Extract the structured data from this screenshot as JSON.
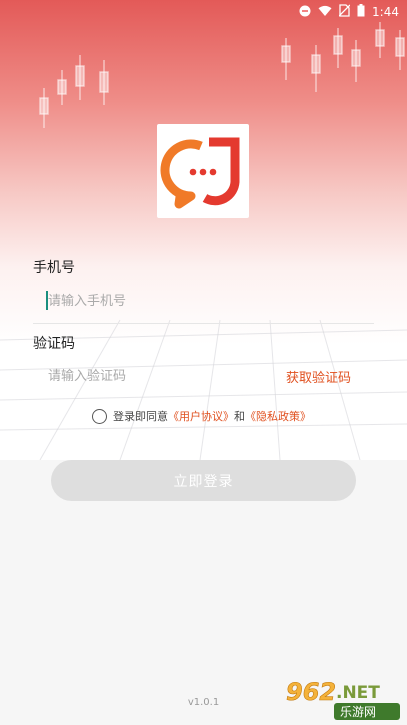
{
  "status_bar": {
    "time": "1:44",
    "icons": [
      "minus-circle-icon",
      "wifi-icon",
      "no-sim-icon",
      "battery-icon"
    ]
  },
  "login": {
    "phone_label": "手机号",
    "phone_placeholder": "请输入手机号",
    "code_label": "验证码",
    "code_placeholder": "请输入验证码",
    "get_code": "获取验证码",
    "agree_prefix": "登录即同意",
    "user_agreement": "《用户协议》",
    "and": "和",
    "privacy_policy": "《隐私政策》",
    "login_button": "立即登录"
  },
  "footer": {
    "version": "v1.0.1"
  },
  "watermark": {
    "top": "962.NET",
    "bottom": "乐游网"
  },
  "colors": {
    "accent": "#e0501f",
    "logo_orange": "#f07a28",
    "logo_red": "#e43a2f",
    "header_red": "#e35a58",
    "button_disabled": "#dedede"
  }
}
